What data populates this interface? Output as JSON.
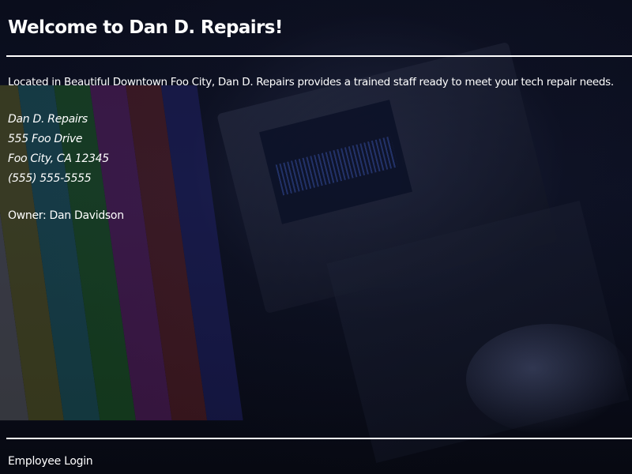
{
  "header": {
    "title": "Welcome to Dan D. Repairs!"
  },
  "main": {
    "intro": "Located in Beautiful Downtown Foo City, Dan D. Repairs provides a trained staff ready to meet your tech repair needs.",
    "address": {
      "name": "Dan D. Repairs",
      "street": "555 Foo Drive",
      "city_state_zip": "Foo City, CA 12345",
      "phone": "(555) 555-5555"
    },
    "owner": "Owner: Dan Davidson"
  },
  "footer": {
    "login_label": "Employee Login"
  },
  "colors": {
    "text": "#ffffff",
    "background": "#05070f",
    "test_bars": [
      "#8a8a8a",
      "#8a8a2a",
      "#2a8a8a",
      "#2a8a2a",
      "#8a2a8a",
      "#8a2a2a",
      "#2a2a8a"
    ]
  }
}
